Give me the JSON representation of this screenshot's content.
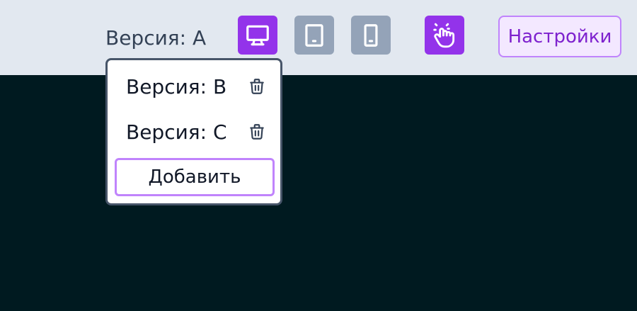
{
  "header": {
    "current_version": "Версия: A",
    "devices": [
      {
        "name": "desktop-icon",
        "active": true
      },
      {
        "name": "tablet-icon",
        "active": false
      },
      {
        "name": "mobile-icon",
        "active": false
      }
    ],
    "interaction_icon": "hand-click-icon",
    "settings_label": "Настройки"
  },
  "dropdown": {
    "items": [
      {
        "label": "Версия: B",
        "action_icon": "trash-icon"
      },
      {
        "label": "Версия: C",
        "action_icon": "trash-icon"
      }
    ],
    "add_label": "Добавить"
  },
  "colors": {
    "accent": "#9333ea",
    "inactive": "#94a3b8",
    "topbar_bg": "#e2e8f0",
    "canvas_bg": "#001a20",
    "settings_border": "#c084fc",
    "settings_text": "#7e22ce"
  }
}
